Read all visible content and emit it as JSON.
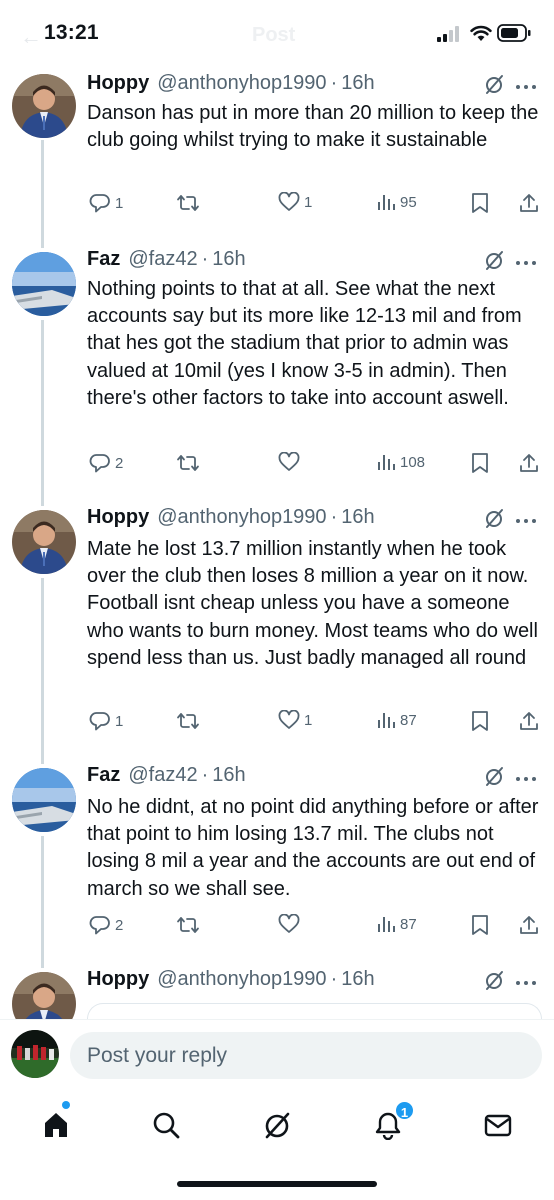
{
  "status_bar": {
    "time": "13:21",
    "ghost_title": "Post"
  },
  "tweets": [
    {
      "name": "Hoppy",
      "handle": "@anthonyhop1990",
      "time": "16h",
      "text": "Danson has put in more than 20 million to keep the club going whilst trying to make it sustainable",
      "replies": "1",
      "reposts": "",
      "likes": "1",
      "views": "95"
    },
    {
      "name": "Faz",
      "handle": "@faz42",
      "time": "16h",
      "text": "Nothing points to that at all.  See what the next accounts say but its more like 12-13 mil and from that hes got the stadium that prior to admin was valued at 10mil (yes I know 3-5 in admin).  Then there's other factors to take into account aswell.",
      "replies": "2",
      "reposts": "",
      "likes": "",
      "views": "108"
    },
    {
      "name": "Hoppy",
      "handle": "@anthonyhop1990",
      "time": "16h",
      "text": "Mate he lost 13.7 million instantly when he took over the club then loses 8 million a year on it now. Football isnt cheap unless you have a someone who wants to burn money. Most teams who do well spend less than us. Just badly managed all round",
      "replies": "1",
      "reposts": "",
      "likes": "1",
      "views": "87"
    },
    {
      "name": "Faz",
      "handle": "@faz42",
      "time": "16h",
      "text": "No he didnt, at no point did anything before or after that point to him losing 13.7 mil.  The clubs not losing 8 mil a year and the accounts are out end of march so we shall see.",
      "replies": "2",
      "reposts": "",
      "likes": "",
      "views": "87"
    },
    {
      "name": "Hoppy",
      "handle": "@anthonyhop1990",
      "time": "16h",
      "text": ""
    }
  ],
  "reply": {
    "placeholder": "Post your reply"
  },
  "tab_bar": {
    "items": [
      "home-icon",
      "search-icon",
      "grok-icon",
      "notifications-icon",
      "messages-icon"
    ],
    "notification_count": "1"
  },
  "colors": {
    "accent": "#1d9bf0",
    "text": "#0f1419",
    "muted": "#536471",
    "thread_line": "#cfd9de"
  }
}
